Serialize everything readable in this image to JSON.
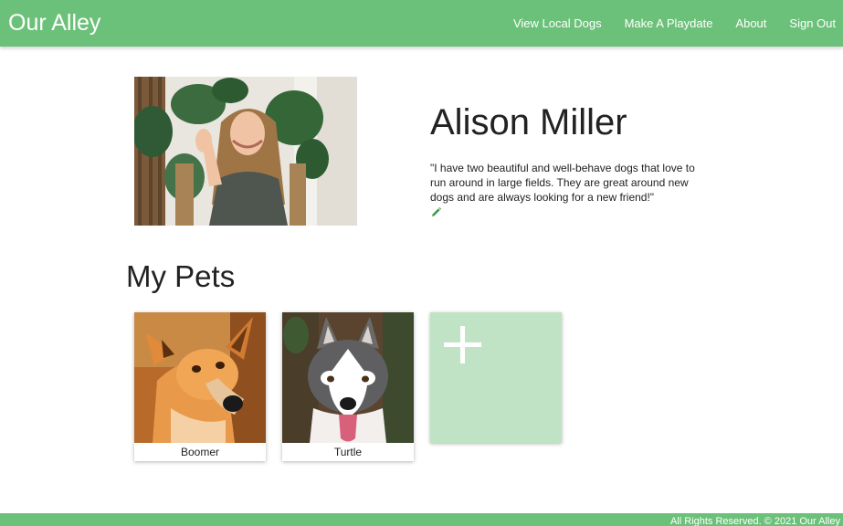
{
  "navbar": {
    "brand": "Our Alley",
    "links": [
      "View Local Dogs",
      "Make A Playdate",
      "About",
      "Sign Out"
    ]
  },
  "profile": {
    "name": "Alison Miller",
    "bio": "\"I have two beautiful and well-behave dogs that love to run around in large fields. They are great around new dogs and are always looking for a new friend!\""
  },
  "pets": {
    "title": "My Pets",
    "items": [
      {
        "name": "Boomer"
      },
      {
        "name": "Turtle"
      }
    ]
  },
  "footer": {
    "text": "All Rights Reserved. © 2021 Our Alley"
  },
  "colors": {
    "brand_green": "#6cc17a",
    "add_card_bg": "#bfe3c4",
    "edit_icon": "#3a9a4a"
  },
  "icons": {
    "edit": "pencil-icon",
    "add": "plus-icon"
  }
}
